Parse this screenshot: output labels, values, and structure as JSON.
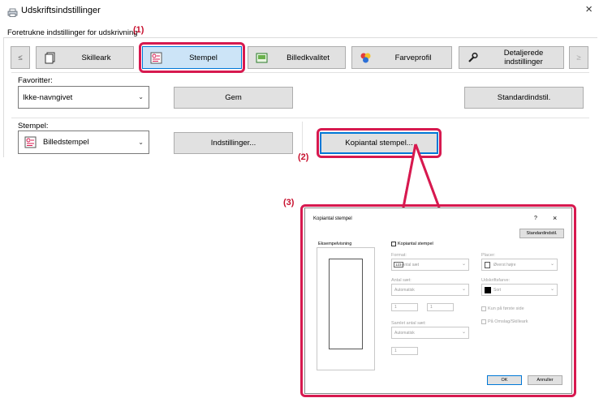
{
  "window": {
    "title": "Udskriftsindstillinger",
    "close_glyph": "×"
  },
  "group_label": "Foretrukne indstillinger for udskrivning",
  "tabs": [
    {
      "label": "Skilleark",
      "icon": "pages-icon"
    },
    {
      "label": "Stempel",
      "icon": "stamp-icon"
    },
    {
      "label": "Billedkvalitet",
      "icon": "image-quality-icon"
    },
    {
      "label": "Farveprofil",
      "icon": "color-profile-icon"
    },
    {
      "label": "Detaljerede indstillinger",
      "icon": "wrench-icon"
    }
  ],
  "nav": {
    "prev": "≤",
    "next": "≥"
  },
  "favorites": {
    "label": "Favoritter:",
    "value": "Ikke-navngivet",
    "save_label": "Gem",
    "default_label": "Standardindstil."
  },
  "stamp": {
    "label": "Stempel:",
    "value": "Billedstempel",
    "settings_label": "Indstillinger...",
    "copy_stamp_label": "Kopiantal stempel..."
  },
  "callouts": {
    "one": "(1)",
    "two": "(2)",
    "three": "(3)"
  },
  "dialog": {
    "title": "Kopiantal stempel",
    "help": "?",
    "close": "×",
    "default_btn": "Standardindstil.",
    "preview_label": "Eksempelvisning",
    "enable_label": "Kopiantal stempel",
    "format_label": "Format:",
    "format_value": "Antal sæt",
    "format_icon_text": "123",
    "position_label": "Placer:",
    "position_value": "Øverst højre",
    "sets_label": "Antal sæt:",
    "sets_value": "Automatisk",
    "print_color_label": "Udskriftsfarve:",
    "print_color_value": "Sort",
    "from_value": "1",
    "to_value": "1",
    "first_page_only": "Kun på første side",
    "on_cover": "På Omslag/Skilleark",
    "total_sets_label": "Samlet antal sæt:",
    "total_sets_value": "Automatisk",
    "total_sets_num": "1",
    "ok": "OK",
    "cancel": "Annuller"
  },
  "colors": {
    "callout_red": "#d7194f",
    "focus_blue": "#0078d7"
  }
}
